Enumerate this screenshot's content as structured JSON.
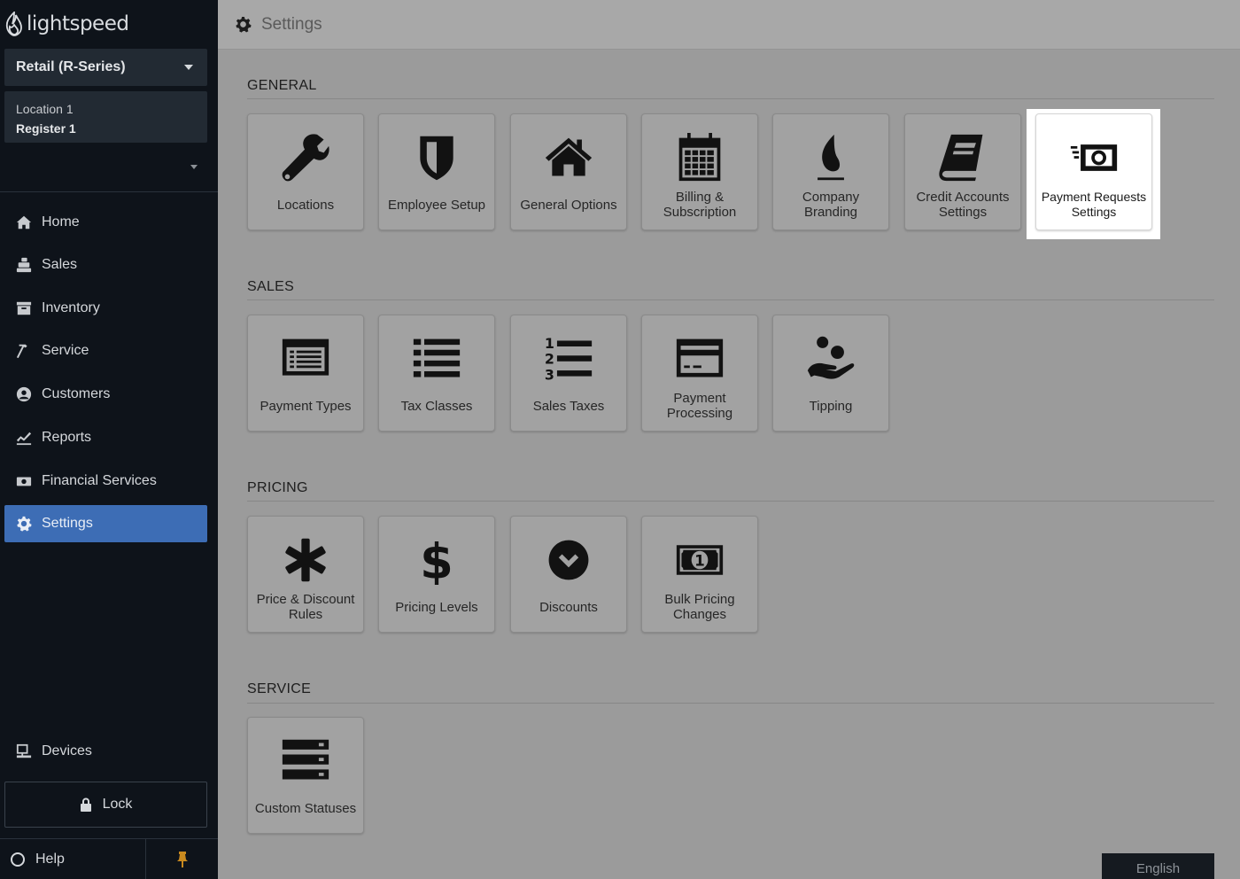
{
  "brand": {
    "logo_text": "lightspeed"
  },
  "sidebar": {
    "product_selector": "Retail (R-Series)",
    "location": "Location 1",
    "register": "Register 1",
    "nav": [
      {
        "label": "Home",
        "icon": "home-icon"
      },
      {
        "label": "Sales",
        "icon": "register-icon"
      },
      {
        "label": "Inventory",
        "icon": "inventory-icon"
      },
      {
        "label": "Service",
        "icon": "hammer-icon"
      },
      {
        "label": "Customers",
        "icon": "customer-icon"
      },
      {
        "label": "Reports",
        "icon": "chart-icon"
      },
      {
        "label": "Financial Services",
        "icon": "money-icon"
      },
      {
        "label": "Settings",
        "icon": "gear-icon",
        "active": true
      }
    ],
    "devices": "Devices",
    "lock": "Lock",
    "help": "Help"
  },
  "header": {
    "title": "Settings"
  },
  "sections": {
    "general": {
      "title": "GENERAL",
      "tiles": [
        {
          "label": "Locations",
          "icon": "wrench-icon"
        },
        {
          "label": "Employee Setup",
          "icon": "shield-icon"
        },
        {
          "label": "General Options",
          "icon": "house-icon"
        },
        {
          "label": "Billing & Subscription",
          "icon": "calendar-icon"
        },
        {
          "label": "Company Branding",
          "icon": "flame-icon"
        },
        {
          "label": "Credit Accounts Settings",
          "icon": "book-icon"
        },
        {
          "label": "Payment Requests Settings",
          "icon": "cash-icon",
          "highlighted": true
        }
      ]
    },
    "sales": {
      "title": "SALES",
      "tiles": [
        {
          "label": "Payment Types",
          "icon": "list-card-icon"
        },
        {
          "label": "Tax Classes",
          "icon": "list-icon"
        },
        {
          "label": "Sales Taxes",
          "icon": "numbered-list-icon"
        },
        {
          "label": "Payment Processing",
          "icon": "credit-card-icon"
        },
        {
          "label": "Tipping",
          "icon": "hand-coins-icon"
        }
      ]
    },
    "pricing": {
      "title": "PRICING",
      "tiles": [
        {
          "label": "Price & Discount Rules",
          "icon": "asterisk-icon"
        },
        {
          "label": "Pricing Levels",
          "icon": "dollar-icon"
        },
        {
          "label": "Discounts",
          "icon": "check-circle-icon"
        },
        {
          "label": "Bulk Pricing Changes",
          "icon": "bill-icon"
        }
      ]
    },
    "service": {
      "title": "SERVICE",
      "tiles": [
        {
          "label": "Custom Statuses",
          "icon": "server-icon"
        }
      ]
    }
  },
  "footer": {
    "language": "English"
  },
  "colors": {
    "sidebar_bg": "#0e131a",
    "active_nav": "#3d6db5",
    "page_bg": "#9b9b9b",
    "pin": "#c98a1f"
  }
}
